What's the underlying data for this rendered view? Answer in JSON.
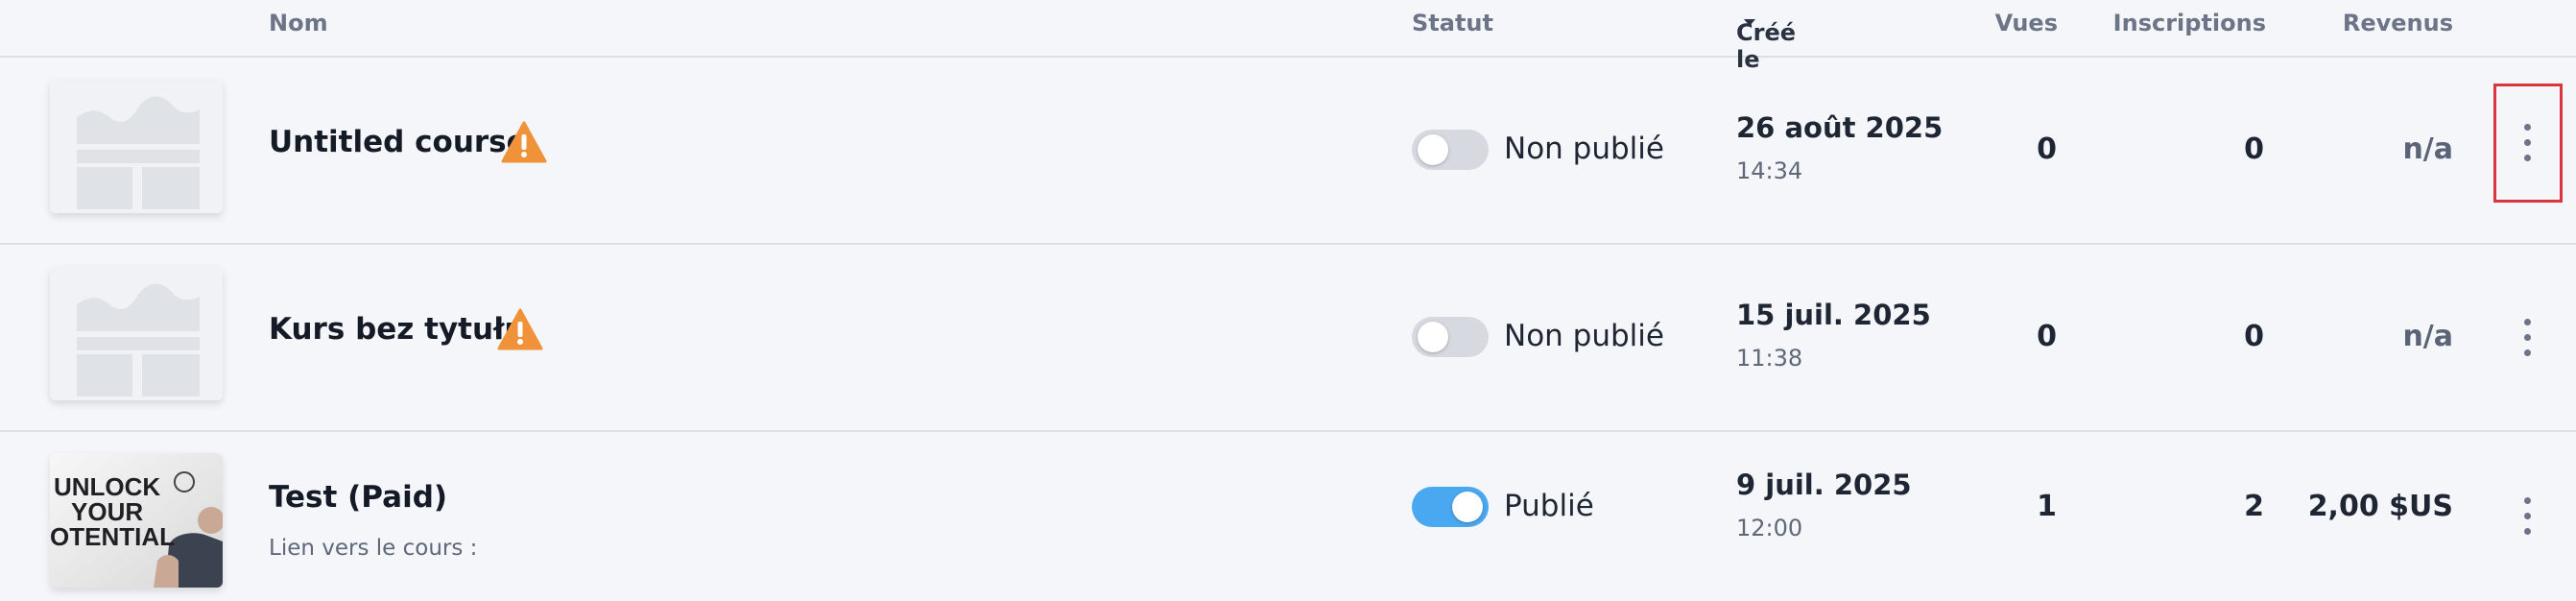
{
  "header": {
    "name": "Nom",
    "status": "Statut",
    "created": "Créé le",
    "views": "Vues",
    "registrations": "Inscriptions",
    "revenue": "Revenus"
  },
  "courses": [
    {
      "title": "Untitled course",
      "warning": true,
      "status_on": false,
      "status_label": "Non publié",
      "date": "26 août 2025",
      "time": "14:34",
      "views": "0",
      "registrations": "0",
      "revenue": "n/a",
      "thumbnail": "placeholder-image-icon"
    },
    {
      "title": "Kurs bez tytułu",
      "warning": true,
      "status_on": false,
      "status_label": "Non publié",
      "date": "15 juil. 2025",
      "time": "11:38",
      "views": "0",
      "registrations": "0",
      "revenue": "n/a",
      "thumbnail": "placeholder-image-icon"
    },
    {
      "title": "Test (Paid)",
      "subtitle": "Lien vers le cours :",
      "warning": false,
      "status_on": true,
      "status_label": "Publié",
      "date": "9 juil. 2025",
      "time": "12:00",
      "views": "1",
      "registrations": "2",
      "revenue": "2,00 $US",
      "thumbnail": "unlock-your-potential-image",
      "thumbnail_text": [
        "UNLOCK",
        "YOUR",
        "OTENTIAL"
      ]
    }
  ],
  "colors": {
    "toggle_on": "#4aa8f0",
    "toggle_off": "#d6d9df",
    "warning": "#f0923a",
    "highlight": "#d9363e"
  }
}
